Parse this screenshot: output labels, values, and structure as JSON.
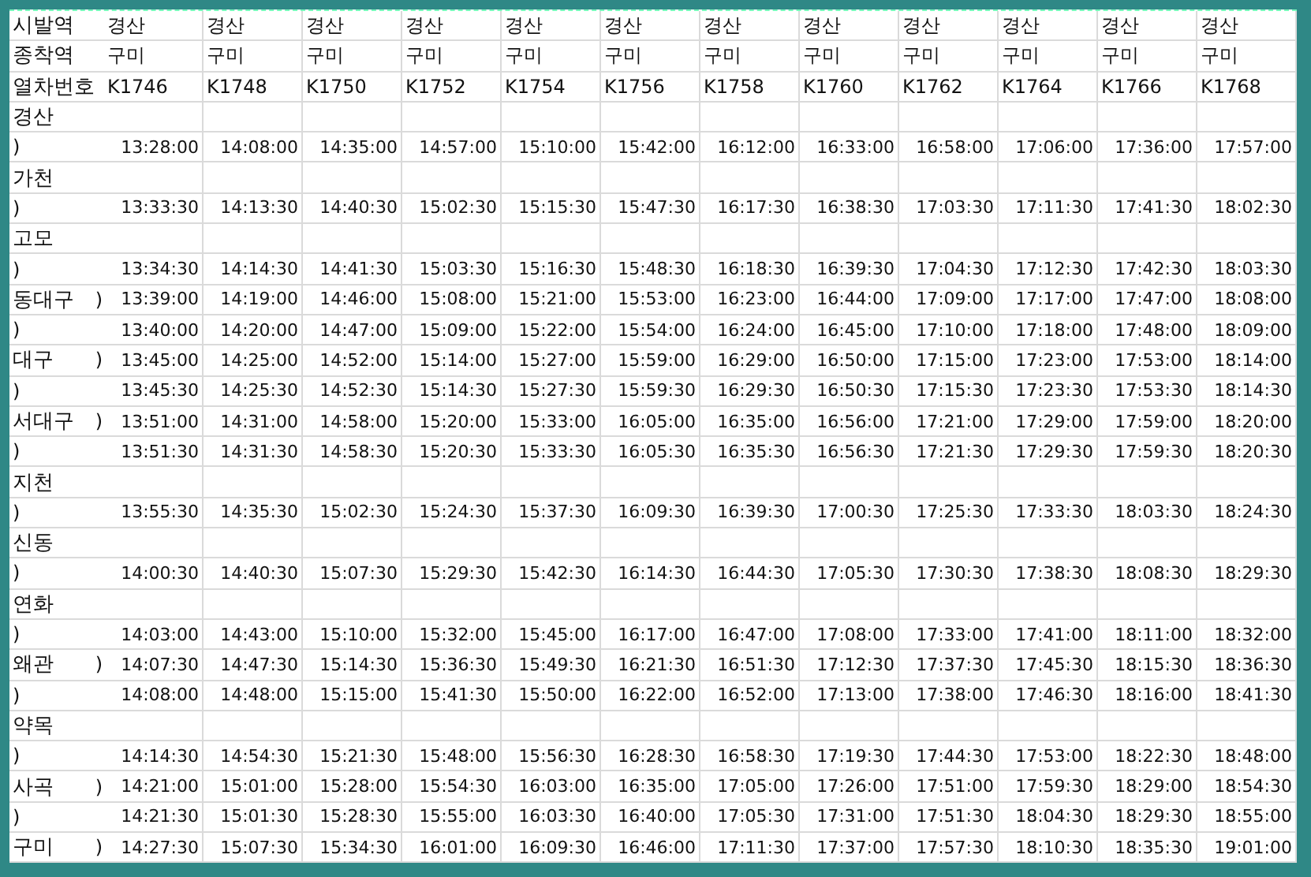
{
  "header_rows": [
    {
      "label": "시발역",
      "cells": [
        "경산",
        "경산",
        "경산",
        "경산",
        "경산",
        "경산",
        "경산",
        "경산",
        "경산",
        "경산",
        "경산",
        "경산"
      ]
    },
    {
      "label": "종착역",
      "cells": [
        "구미",
        "구미",
        "구미",
        "구미",
        "구미",
        "구미",
        "구미",
        "구미",
        "구미",
        "구미",
        "구미",
        "구미"
      ]
    },
    {
      "label": "열차번호",
      "cells": [
        "K1746",
        "K1748",
        "K1750",
        "K1752",
        "K1754",
        "K1756",
        "K1758",
        "K1760",
        "K1762",
        "K1764",
        "K1766",
        "K1768"
      ]
    }
  ],
  "rows": [
    {
      "station": "경산"
    },
    {
      "edge": ")",
      "times": [
        "13:28:00",
        "14:08:00",
        "14:35:00",
        "14:57:00",
        "15:10:00",
        "15:42:00",
        "16:12:00",
        "16:33:00",
        "16:58:00",
        "17:06:00",
        "17:36:00",
        "17:57:00"
      ]
    },
    {
      "station": "가천"
    },
    {
      "edge": ")",
      "times": [
        "13:33:30",
        "14:13:30",
        "14:40:30",
        "15:02:30",
        "15:15:30",
        "15:47:30",
        "16:17:30",
        "16:38:30",
        "17:03:30",
        "17:11:30",
        "17:41:30",
        "18:02:30"
      ]
    },
    {
      "station": "고모"
    },
    {
      "edge": ")",
      "times": [
        "13:34:30",
        "14:14:30",
        "14:41:30",
        "15:03:30",
        "15:16:30",
        "15:48:30",
        "16:18:30",
        "16:39:30",
        "17:04:30",
        "17:12:30",
        "17:42:30",
        "18:03:30"
      ]
    },
    {
      "station": "동대구",
      "edge": ")",
      "times": [
        "13:39:00",
        "14:19:00",
        "14:46:00",
        "15:08:00",
        "15:21:00",
        "15:53:00",
        "16:23:00",
        "16:44:00",
        "17:09:00",
        "17:17:00",
        "17:47:00",
        "18:08:00"
      ]
    },
    {
      "edge": ")",
      "times": [
        "13:40:00",
        "14:20:00",
        "14:47:00",
        "15:09:00",
        "15:22:00",
        "15:54:00",
        "16:24:00",
        "16:45:00",
        "17:10:00",
        "17:18:00",
        "17:48:00",
        "18:09:00"
      ]
    },
    {
      "station": "대구",
      "edge": ")",
      "times": [
        "13:45:00",
        "14:25:00",
        "14:52:00",
        "15:14:00",
        "15:27:00",
        "15:59:00",
        "16:29:00",
        "16:50:00",
        "17:15:00",
        "17:23:00",
        "17:53:00",
        "18:14:00"
      ]
    },
    {
      "edge": ")",
      "times": [
        "13:45:30",
        "14:25:30",
        "14:52:30",
        "15:14:30",
        "15:27:30",
        "15:59:30",
        "16:29:30",
        "16:50:30",
        "17:15:30",
        "17:23:30",
        "17:53:30",
        "18:14:30"
      ]
    },
    {
      "station": "서대구",
      "edge": ")",
      "times": [
        "13:51:00",
        "14:31:00",
        "14:58:00",
        "15:20:00",
        "15:33:00",
        "16:05:00",
        "16:35:00",
        "16:56:00",
        "17:21:00",
        "17:29:00",
        "17:59:00",
        "18:20:00"
      ]
    },
    {
      "edge": ")",
      "times": [
        "13:51:30",
        "14:31:30",
        "14:58:30",
        "15:20:30",
        "15:33:30",
        "16:05:30",
        "16:35:30",
        "16:56:30",
        "17:21:30",
        "17:29:30",
        "17:59:30",
        "18:20:30"
      ]
    },
    {
      "station": "지천"
    },
    {
      "edge": ")",
      "times": [
        "13:55:30",
        "14:35:30",
        "15:02:30",
        "15:24:30",
        "15:37:30",
        "16:09:30",
        "16:39:30",
        "17:00:30",
        "17:25:30",
        "17:33:30",
        "18:03:30",
        "18:24:30"
      ]
    },
    {
      "station": "신동"
    },
    {
      "edge": ")",
      "times": [
        "14:00:30",
        "14:40:30",
        "15:07:30",
        "15:29:30",
        "15:42:30",
        "16:14:30",
        "16:44:30",
        "17:05:30",
        "17:30:30",
        "17:38:30",
        "18:08:30",
        "18:29:30"
      ]
    },
    {
      "station": "연화"
    },
    {
      "edge": ")",
      "times": [
        "14:03:00",
        "14:43:00",
        "15:10:00",
        "15:32:00",
        "15:45:00",
        "16:17:00",
        "16:47:00",
        "17:08:00",
        "17:33:00",
        "17:41:00",
        "18:11:00",
        "18:32:00"
      ]
    },
    {
      "station": "왜관",
      "edge": ")",
      "times": [
        "14:07:30",
        "14:47:30",
        "15:14:30",
        "15:36:30",
        "15:49:30",
        "16:21:30",
        "16:51:30",
        "17:12:30",
        "17:37:30",
        "17:45:30",
        "18:15:30",
        "18:36:30"
      ]
    },
    {
      "edge": ")",
      "times": [
        "14:08:00",
        "14:48:00",
        "15:15:00",
        "15:41:30",
        "15:50:00",
        "16:22:00",
        "16:52:00",
        "17:13:00",
        "17:38:00",
        "17:46:30",
        "18:16:00",
        "18:41:30"
      ]
    },
    {
      "station": "약목"
    },
    {
      "edge": ")",
      "times": [
        "14:14:30",
        "14:54:30",
        "15:21:30",
        "15:48:00",
        "15:56:30",
        "16:28:30",
        "16:58:30",
        "17:19:30",
        "17:44:30",
        "17:53:00",
        "18:22:30",
        "18:48:00"
      ]
    },
    {
      "station": "사곡",
      "edge": ")",
      "times": [
        "14:21:00",
        "15:01:00",
        "15:28:00",
        "15:54:30",
        "16:03:00",
        "16:35:00",
        "17:05:00",
        "17:26:00",
        "17:51:00",
        "17:59:30",
        "18:29:00",
        "18:54:30"
      ]
    },
    {
      "edge": ")",
      "times": [
        "14:21:30",
        "15:01:30",
        "15:28:30",
        "15:55:00",
        "16:03:30",
        "16:40:00",
        "17:05:30",
        "17:31:00",
        "17:51:30",
        "18:04:30",
        "18:29:30",
        "18:55:00"
      ]
    },
    {
      "station": "구미",
      "edge": ")",
      "times": [
        "14:27:30",
        "15:07:30",
        "15:34:30",
        "16:01:00",
        "16:09:30",
        "16:46:00",
        "17:11:30",
        "17:37:00",
        "17:57:30",
        "18:10:30",
        "18:35:30",
        "19:01:00"
      ]
    }
  ]
}
